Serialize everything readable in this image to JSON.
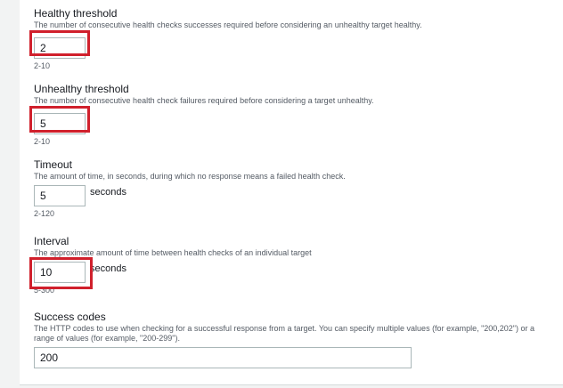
{
  "fields": {
    "healthy": {
      "label": "Healthy threshold",
      "description": "The number of consecutive health checks successes required before considering an unhealthy target healthy.",
      "value": "2",
      "hint": "2-10"
    },
    "unhealthy": {
      "label": "Unhealthy threshold",
      "description": "The number of consecutive health check failures required before considering a target unhealthy.",
      "value": "5",
      "hint": "2-10"
    },
    "timeout": {
      "label": "Timeout",
      "description": "The amount of time, in seconds, during which no response means a failed health check.",
      "value": "5",
      "unit": "seconds",
      "hint": "2-120"
    },
    "interval": {
      "label": "Interval",
      "description": "The approximate amount of time between health checks of an individual target",
      "value": "10",
      "unit": "seconds",
      "hint": "5-300"
    },
    "success_codes": {
      "label": "Success codes",
      "description": "The HTTP codes to use when checking for a successful response from a target. You can specify multiple values (for example, \"200,202\") or a range of values (for example, \"200-299\").",
      "value": "200"
    }
  },
  "colors": {
    "highlight": "#d0202c",
    "panel": "#ffffff",
    "background": "#f2f3f3"
  }
}
